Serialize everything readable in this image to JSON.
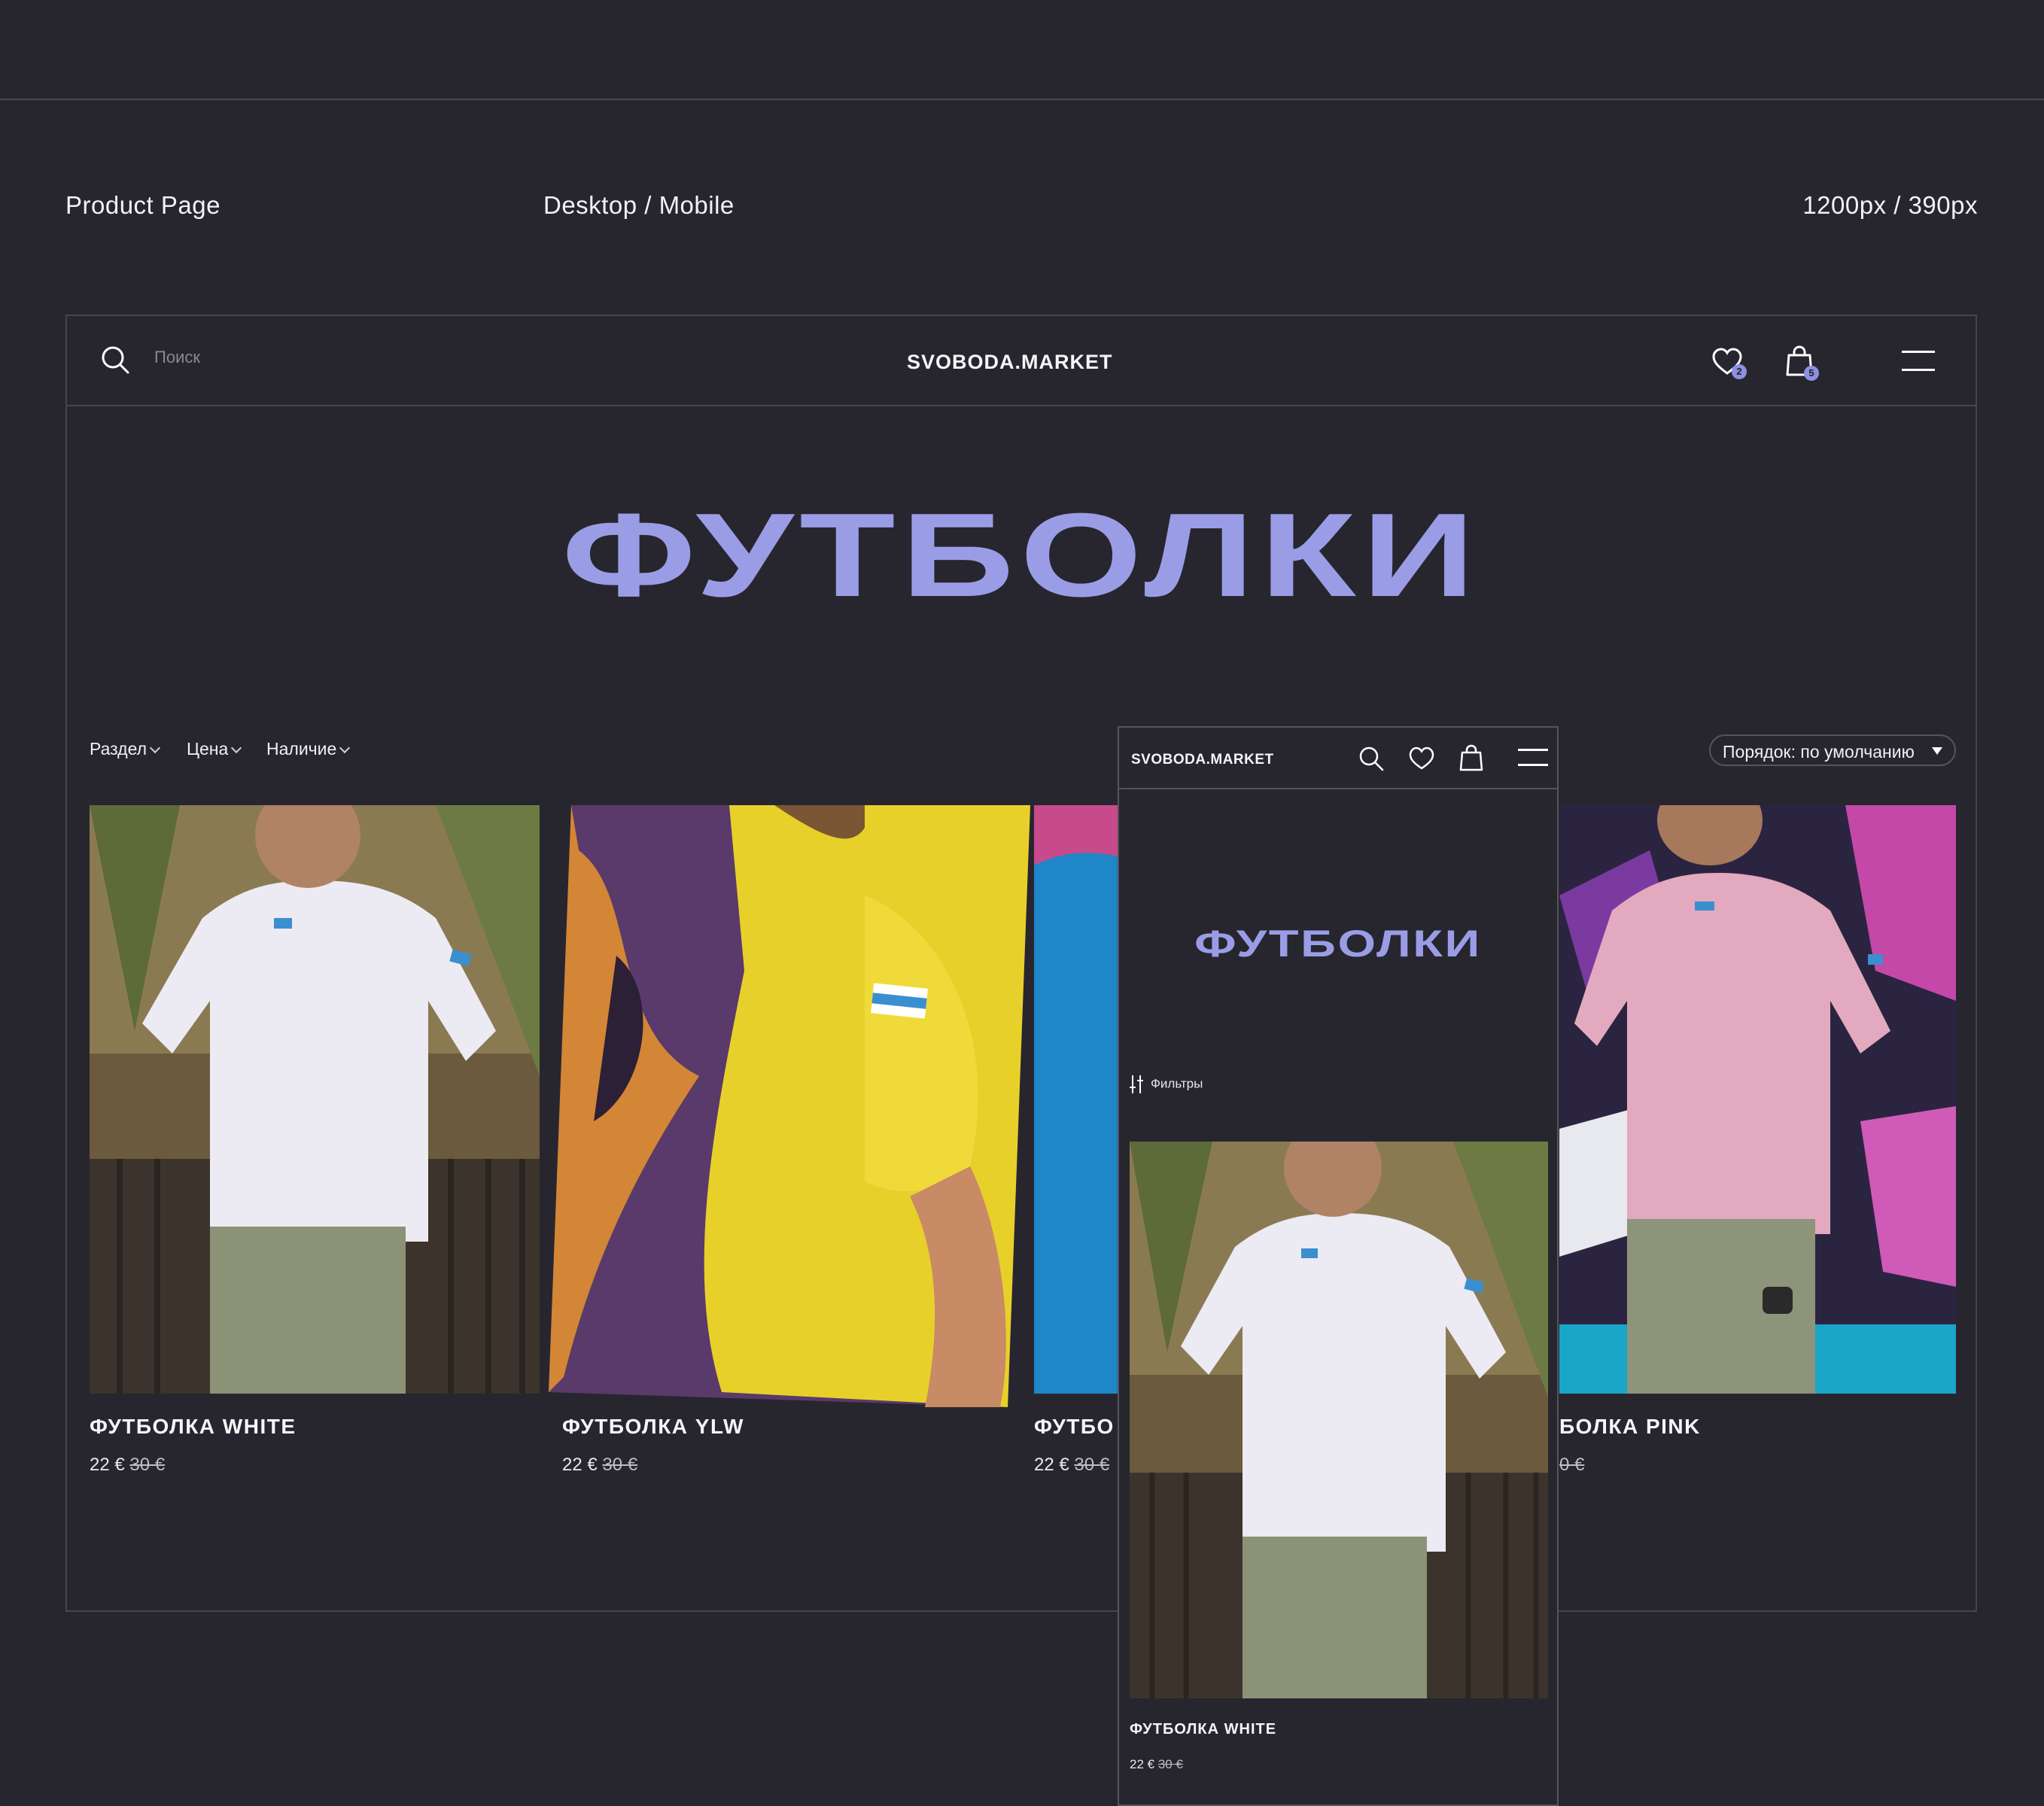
{
  "presentation": {
    "page_label": "Product Page",
    "devices_label": "Desktop / Mobile",
    "sizes_label": "1200px / 390px"
  },
  "desktop": {
    "header": {
      "search_placeholder": "Поиск",
      "logo": "SVOBODA.MARKET",
      "favorites_count": "2",
      "cart_count": "5"
    },
    "title": "ФУТБОЛКИ",
    "filters": [
      "Раздел",
      "Цена",
      "Наличие"
    ],
    "sort_label": "Порядок: по умолчанию",
    "products": [
      {
        "name": "ФУТБОЛКА WHITE",
        "price": "22 €",
        "old_price": "30 €"
      },
      {
        "name": "ФУТБОЛКА YLW",
        "price": "22 €",
        "old_price": "30 €"
      },
      {
        "name": "ФУТБО",
        "price": "22 €",
        "old_price": "30 €"
      },
      {
        "name": "БОЛКА PINK",
        "price": "",
        "old_price": "0 €"
      }
    ]
  },
  "mobile": {
    "logo": "SVOBODA.MARKET",
    "title": "ФУТБОЛКИ",
    "filters_label": "Фильтры",
    "product": {
      "name": "ФУТБОЛКА WHITE",
      "price": "22 €",
      "old_price": "30 €"
    }
  },
  "colors": {
    "background": "#27262e",
    "accent": "#9a9de6",
    "border": "#46454c",
    "text": "#ffffff"
  }
}
